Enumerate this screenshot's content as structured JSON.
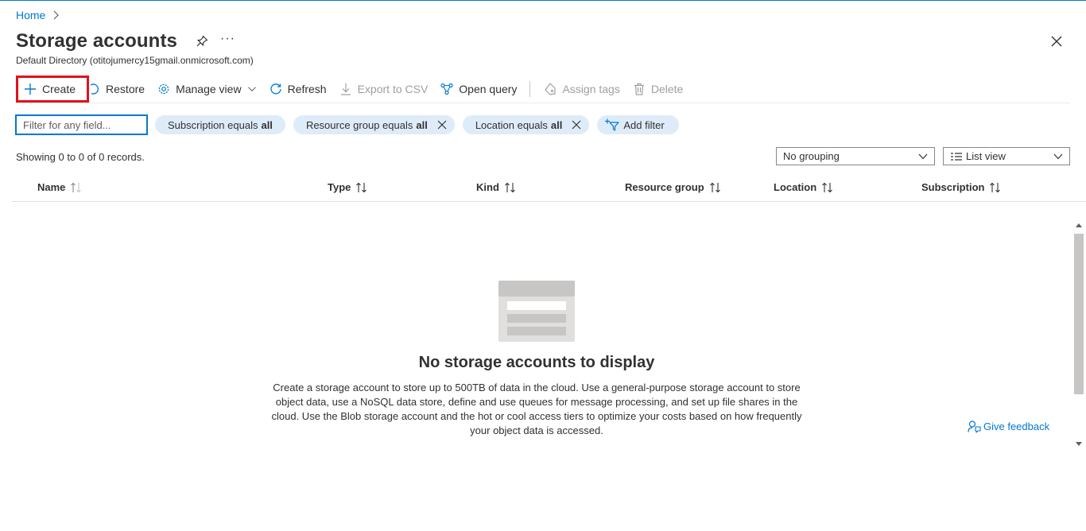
{
  "breadcrumb": {
    "home": "Home"
  },
  "header": {
    "title": "Storage accounts",
    "more": "···",
    "subtitle": "Default Directory (otitojumercy15gmail.onmicrosoft.com)"
  },
  "toolbar": {
    "create": "Create",
    "restore": "Restore",
    "manage_view": "Manage view",
    "refresh": "Refresh",
    "export_csv": "Export to CSV",
    "open_query": "Open query",
    "assign_tags": "Assign tags",
    "delete": "Delete"
  },
  "filters": {
    "search_placeholder": "Filter for any field...",
    "subscription_label": "Subscription equals",
    "subscription_value": "all",
    "resource_group_label": "Resource group equals",
    "resource_group_value": "all",
    "location_label": "Location equals",
    "location_value": "all",
    "add_filter": "Add filter"
  },
  "records_text": "Showing 0 to 0 of 0 records.",
  "grouping": {
    "selected": "No grouping"
  },
  "view": {
    "selected": "List view"
  },
  "columns": [
    "Name",
    "Type",
    "Kind",
    "Resource group",
    "Location",
    "Subscription"
  ],
  "empty": {
    "title": "No storage accounts to display",
    "description": "Create a storage account to store up to 500TB of data in the cloud. Use a general-purpose storage account to store object data, use a NoSQL data store, define and use queues for message processing, and set up file shares in the cloud. Use the Blob storage account and the hot or cool access tiers to optimize your costs based on how frequently your object data is accessed."
  },
  "feedback": {
    "label": "Give feedback"
  },
  "colors": {
    "accent": "#0078d4",
    "highlight": "#e3101c",
    "pill": "#deecf9"
  }
}
